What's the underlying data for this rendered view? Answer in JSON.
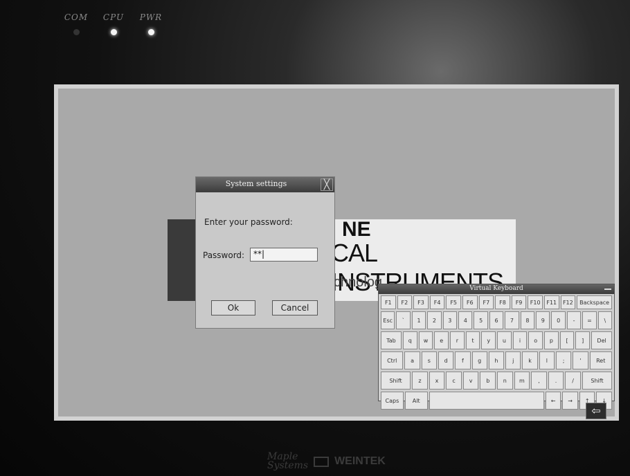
{
  "panel": {
    "leds": [
      {
        "label": "COM",
        "state": "off"
      },
      {
        "label": "CPU",
        "state": "on"
      },
      {
        "label": "PWR",
        "state": "on"
      }
    ],
    "brand": {
      "maker_line1": "Maple",
      "maker_line2": "Systems",
      "oem": "WEINTEK"
    }
  },
  "background_logo": {
    "line1": "NE",
    "line2": "CAL INSTRUMENTS",
    "line3": "chnolog"
  },
  "dialog": {
    "title": "System settings",
    "close_glyph": "╳",
    "prompt": "Enter your password:",
    "password_label": "Password:",
    "password_value": "**|",
    "ok_label": "Ok",
    "cancel_label": "Cancel"
  },
  "keyboard": {
    "title": "Virtual Keyboard",
    "rows": [
      {
        "name": "function",
        "keys": [
          "F1",
          "F2",
          "F3",
          "F4",
          "F5",
          "F6",
          "F7",
          "F8",
          "F9",
          "F10",
          "F11",
          "F12",
          "Backspace"
        ]
      },
      {
        "name": "number",
        "keys": [
          "Esc",
          "`",
          "1",
          "2",
          "3",
          "4",
          "5",
          "6",
          "7",
          "8",
          "9",
          "0",
          "-",
          "=",
          "\\"
        ]
      },
      {
        "name": "top",
        "keys": [
          "Tab",
          "q",
          "w",
          "e",
          "r",
          "t",
          "y",
          "u",
          "i",
          "o",
          "p",
          "[",
          "]",
          "Del"
        ]
      },
      {
        "name": "home",
        "keys": [
          "Ctrl",
          "a",
          "s",
          "d",
          "f",
          "g",
          "h",
          "j",
          "k",
          "l",
          ";",
          "'",
          "Ret"
        ]
      },
      {
        "name": "bottom",
        "keys": [
          "Shift",
          "z",
          "x",
          "c",
          "v",
          "b",
          "n",
          "m",
          ",",
          ".",
          "/",
          "Shift"
        ]
      },
      {
        "name": "modifier",
        "keys": [
          "Caps",
          "Alt",
          "",
          "←",
          "→",
          "↑",
          "↓"
        ]
      }
    ]
  },
  "screen_back_button": {
    "glyph": "⇦"
  }
}
